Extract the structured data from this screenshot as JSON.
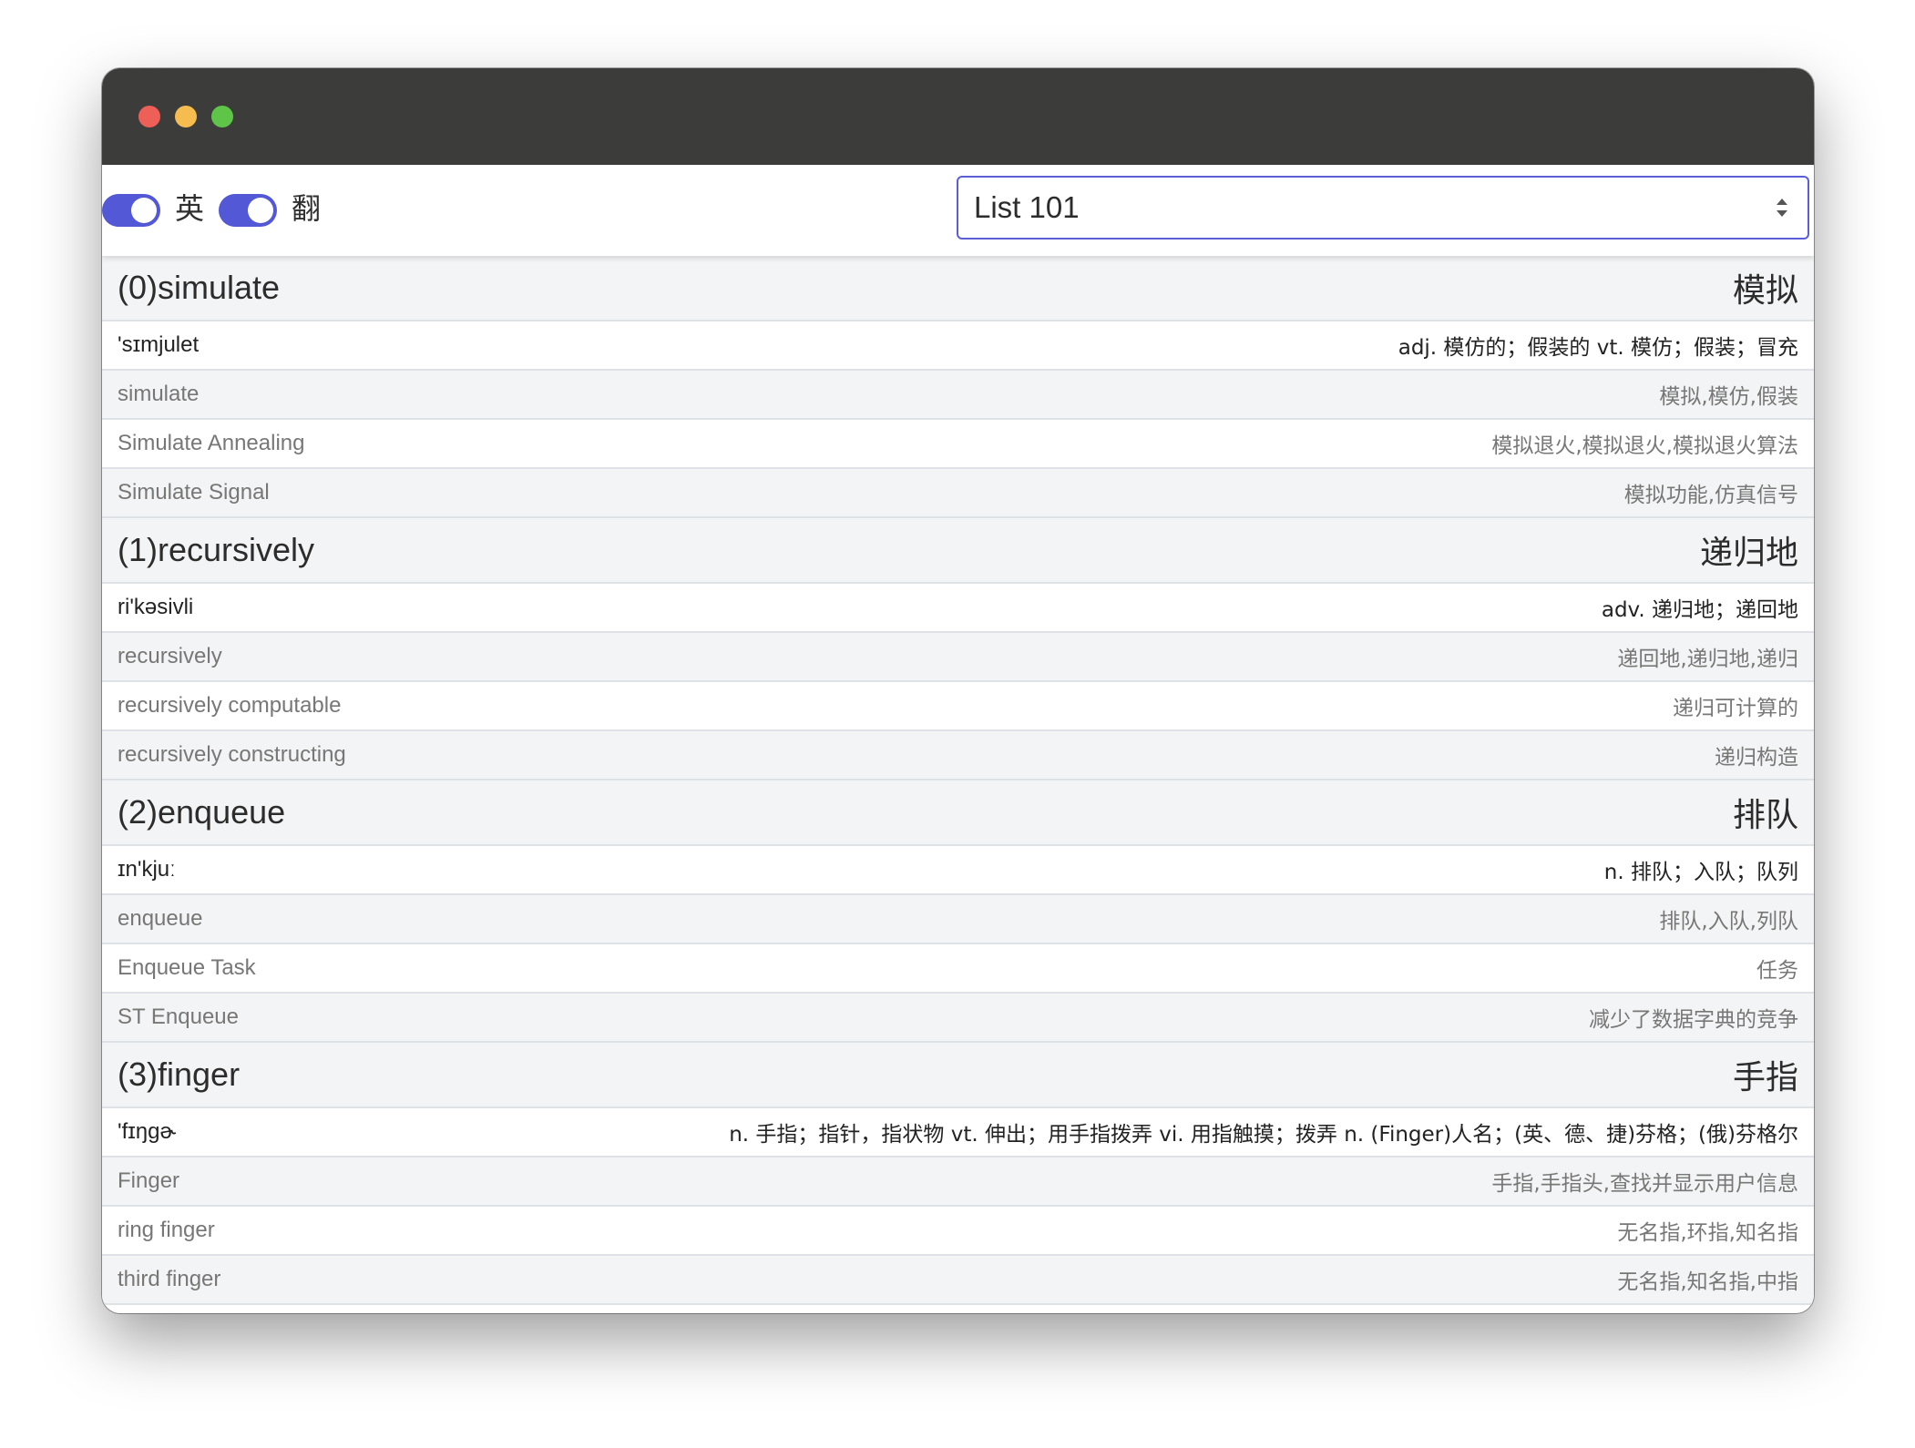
{
  "toolbar": {
    "toggle1_label": "英",
    "toggle2_label": "翻",
    "list_select_value": "List 101"
  },
  "words": [
    {
      "title": "(0)simulate",
      "meaning": "模拟",
      "phonetic": "'sɪmjulet",
      "definition": "adj. 模仿的；假装的 vt. 模仿；假装；冒充",
      "phrases": [
        {
          "en": "simulate",
          "zh": "模拟,模仿,假装"
        },
        {
          "en": "Simulate Annealing",
          "zh": "模拟退火,模拟退火,模拟退火算法"
        },
        {
          "en": "Simulate Signal",
          "zh": "模拟功能,仿真信号"
        }
      ]
    },
    {
      "title": "(1)recursively",
      "meaning": "递归地",
      "phonetic": "ri'kəsivli",
      "definition": "adv. 递归地；递回地",
      "phrases": [
        {
          "en": "recursively",
          "zh": "递回地,递归地,递归"
        },
        {
          "en": "recursively computable",
          "zh": "递归可计算的"
        },
        {
          "en": "recursively constructing",
          "zh": "递归构造"
        }
      ]
    },
    {
      "title": "(2)enqueue",
      "meaning": "排队",
      "phonetic": "ɪn'kjuː",
      "definition": "n. 排队；入队；队列",
      "phrases": [
        {
          "en": "enqueue",
          "zh": "排队,入队,列队"
        },
        {
          "en": "Enqueue Task",
          "zh": "任务"
        },
        {
          "en": "ST Enqueue",
          "zh": "减少了数据字典的竞争"
        }
      ]
    },
    {
      "title": "(3)finger",
      "meaning": "手指",
      "phonetic": "'fɪŋɡɚ",
      "definition": "n. 手指；指针，指状物 vt. 伸出；用手指拨弄 vi. 用指触摸；拨弄 n. (Finger)人名；(英、德、捷)芬格；(俄)芬格尔",
      "phrases": [
        {
          "en": "Finger",
          "zh": "手指,手指头,查找并显示用户信息"
        },
        {
          "en": "ring finger",
          "zh": "无名指,环指,知名指"
        },
        {
          "en": "third finger",
          "zh": "无名指,知名指,中指"
        }
      ]
    }
  ]
}
